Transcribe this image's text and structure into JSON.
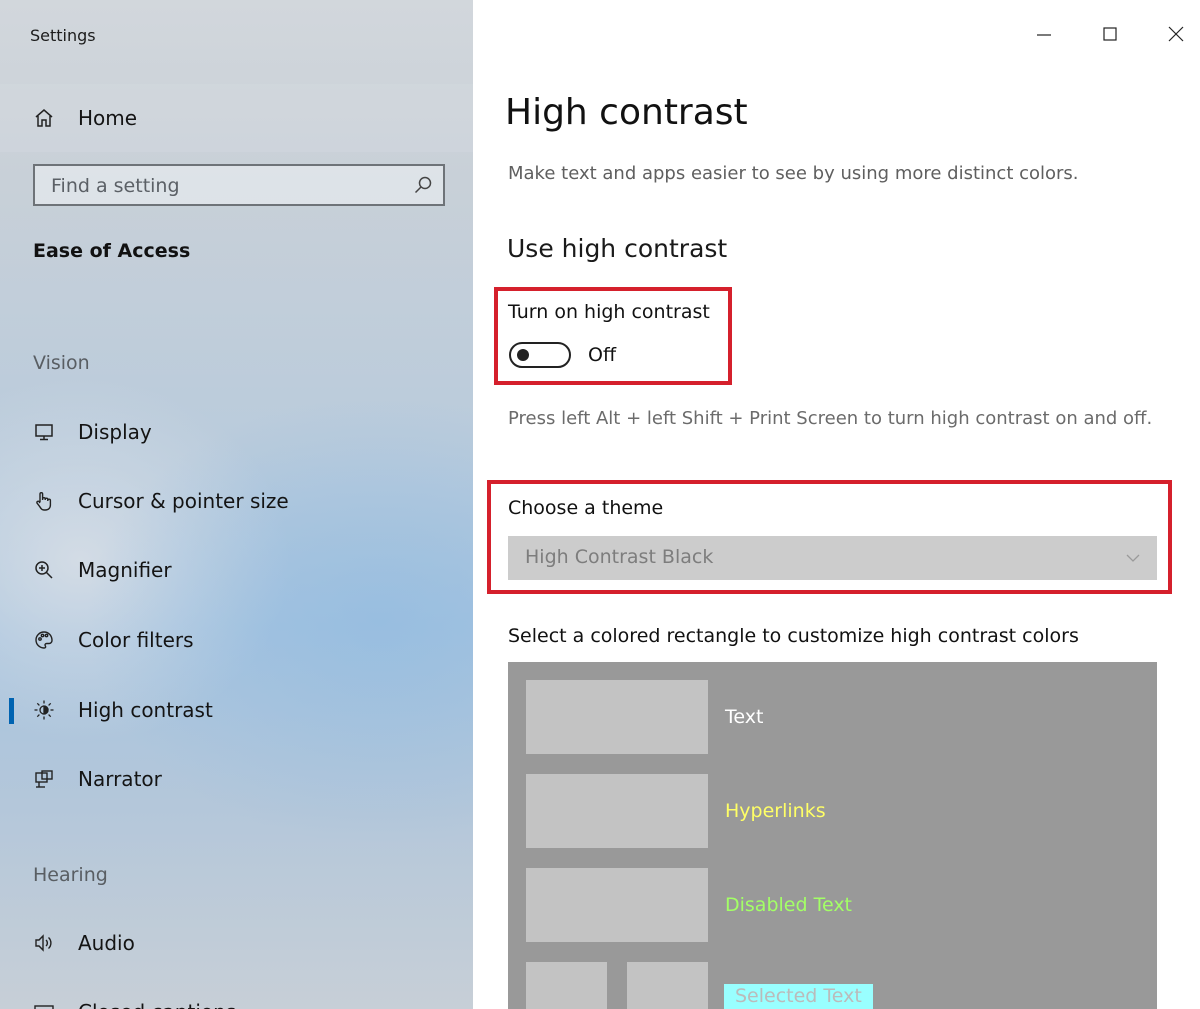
{
  "window": {
    "title": "Settings",
    "minimize_icon": "minimize-icon",
    "maximize_icon": "maximize-icon",
    "close_icon": "close-icon"
  },
  "sidebar": {
    "home_label": "Home",
    "search": {
      "placeholder": "Find a setting"
    },
    "section_title": "Ease of Access",
    "vision_header": "Vision",
    "hearing_header": "Hearing",
    "items": [
      {
        "label": "Display",
        "icon": "monitor-icon"
      },
      {
        "label": "Cursor & pointer size",
        "icon": "pointer-hand-icon"
      },
      {
        "label": "Magnifier",
        "icon": "magnifier-icon"
      },
      {
        "label": "Color filters",
        "icon": "palette-icon"
      },
      {
        "label": "High contrast",
        "icon": "brightness-icon",
        "selected": true
      },
      {
        "label": "Narrator",
        "icon": "narrator-icon"
      },
      {
        "label": "Audio",
        "icon": "speaker-icon"
      },
      {
        "label": "Closed captions",
        "icon": "captions-icon"
      }
    ]
  },
  "main": {
    "title": "High contrast",
    "description": "Make text and apps easier to see by using more distinct colors.",
    "subtitle": "Use high contrast",
    "toggle": {
      "label": "Turn on high contrast",
      "state": "Off"
    },
    "hint": "Press left Alt + left Shift + Print Screen to turn high contrast on and off.",
    "theme": {
      "label": "Choose a theme",
      "selected": "High Contrast Black"
    },
    "customize_label": "Select a colored rectangle to customize high contrast colors",
    "swatches": {
      "text": "Text",
      "hyperlinks": "Hyperlinks",
      "disabled_text": "Disabled Text",
      "selected_text": "Selected Text"
    }
  },
  "colors": {
    "highlight_box": "#d5202c",
    "accent": "#0063b1",
    "preview_bg": "#999999",
    "swatch": "#c3c3c3",
    "text_label": "#ffffff",
    "hyperlink_label": "#ffff66",
    "disabled_label": "#a3ff66",
    "selected_bg": "#99ffff"
  }
}
